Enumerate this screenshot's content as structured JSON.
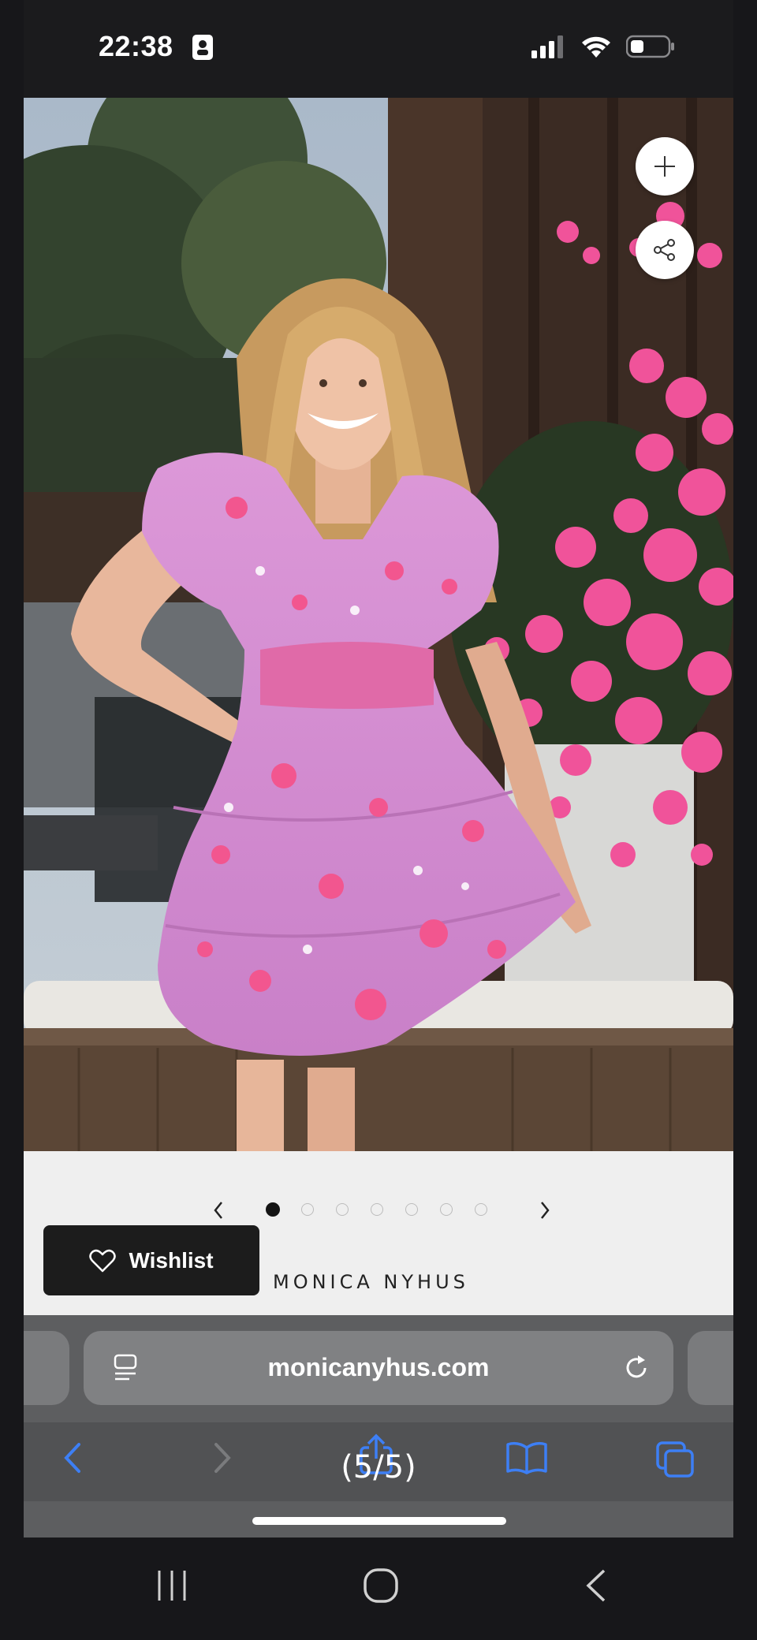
{
  "status_bar": {
    "time": "22:38",
    "icons": [
      "person-id-icon",
      "signal-icon",
      "wifi-icon",
      "battery-icon"
    ]
  },
  "product": {
    "image_actions": [
      "plus-icon",
      "share-icon"
    ],
    "pager": {
      "total": 7,
      "active_index": 0
    },
    "wishlist_label": "Wishlist",
    "brand": "MONICA NYHUS"
  },
  "browser": {
    "url": "monicanyhus.com",
    "counter": "(5/5)",
    "toolbar_icons": [
      "back-icon",
      "forward-icon",
      "share-icon",
      "bookmarks-icon",
      "tabs-icon"
    ]
  },
  "colors": {
    "dress": "#d98fd6",
    "blossom": "#f0539a",
    "browser_accent": "#3d7ff5"
  }
}
